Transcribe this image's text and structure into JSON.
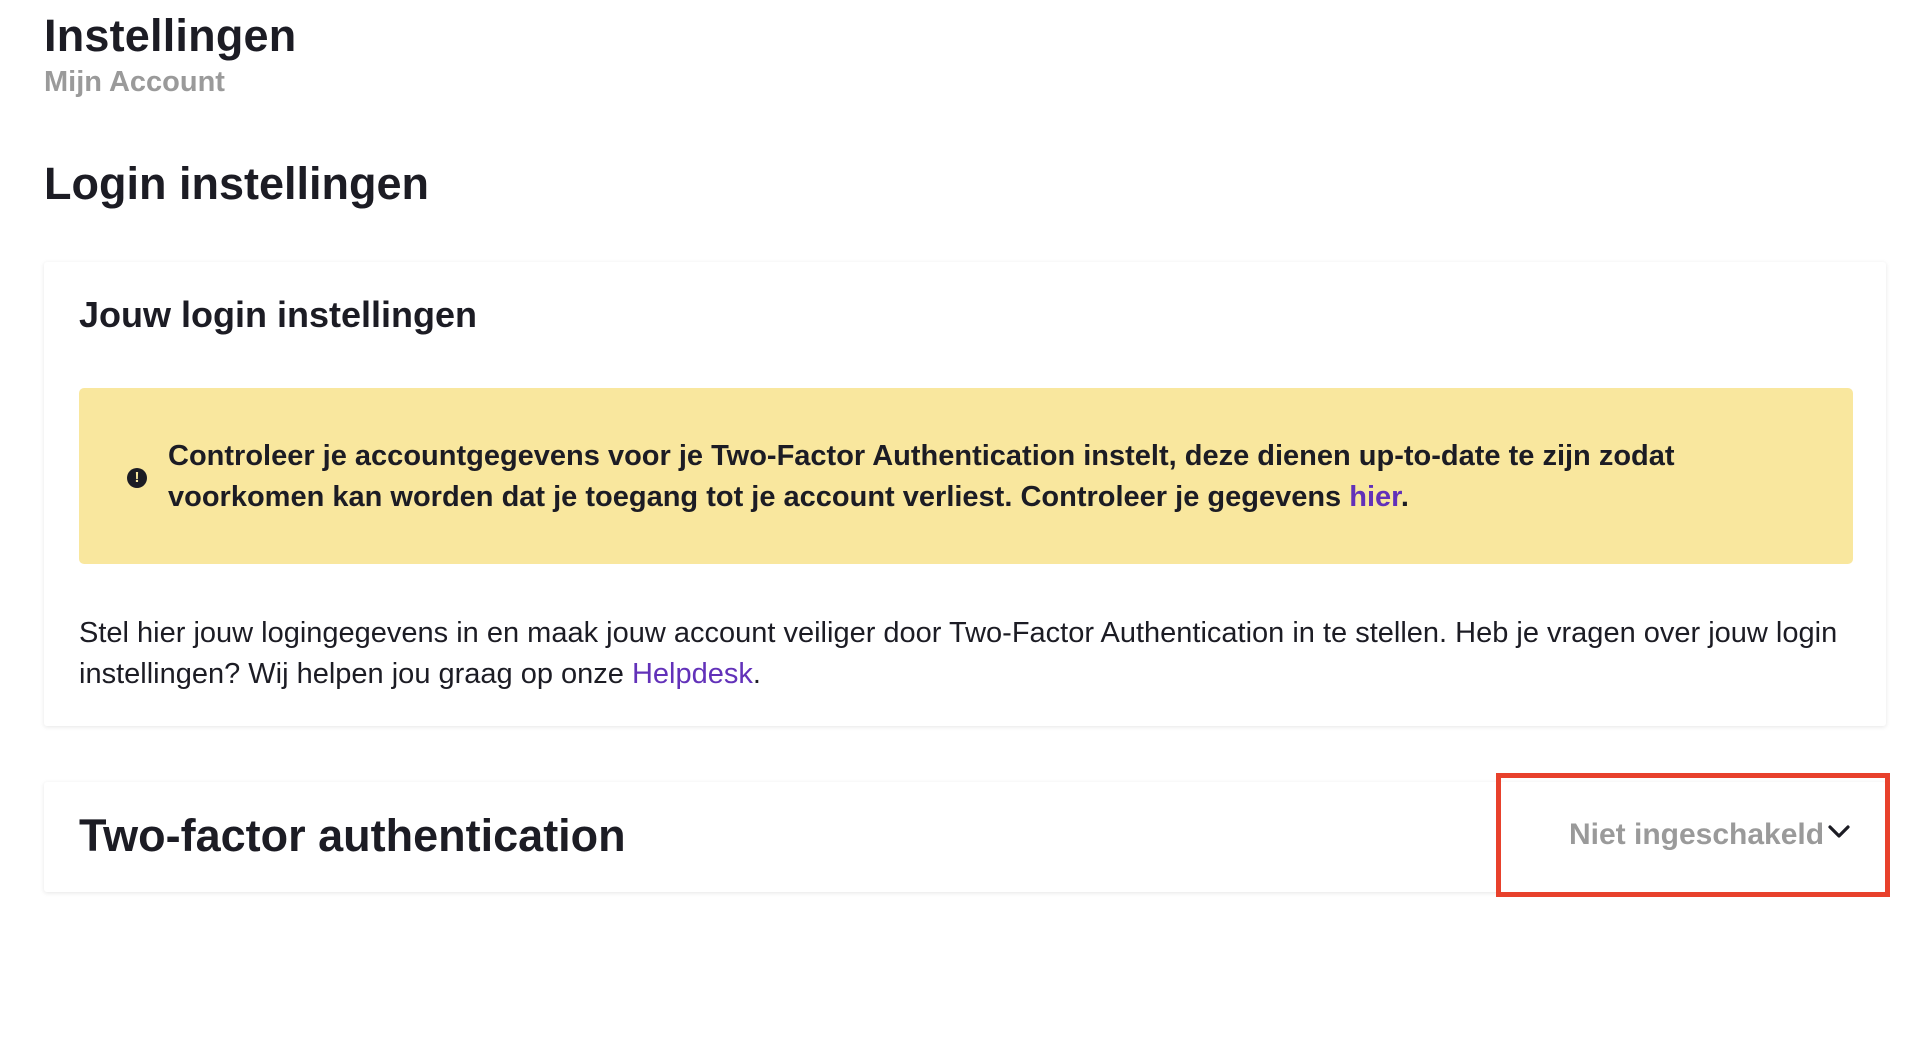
{
  "header": {
    "title": "Instellingen",
    "subtitle": "Mijn Account"
  },
  "section": {
    "title": "Login instellingen"
  },
  "login_card": {
    "heading": "Jouw login instellingen",
    "alert": {
      "icon": "exclamation-circle-icon",
      "text_before_link": "Controleer je accountgegevens voor je Two-Factor Authentication instelt, deze dienen up-to-date te zijn zodat voorkomen kan worden dat je toegang tot je account verliest. Controleer je gegevens ",
      "link_label": "hier",
      "text_after_link": "."
    },
    "body": {
      "text_before_link": "Stel hier jouw logingegevens in en maak jouw account veiliger door Two-Factor Authentication in te stellen. Heb je vragen over jouw login instellingen? Wij helpen jou graag op onze ",
      "link_label": "Helpdesk",
      "text_after_link": "."
    }
  },
  "twofa_card": {
    "title": "Two-factor authentication",
    "status": "Niet ingeschakeld",
    "toggle_icon": "chevron-down-icon"
  },
  "colors": {
    "alert_background": "#f9e79e",
    "link": "#6231b9",
    "muted_text": "#9a9a9a",
    "highlight_border": "#e8412c"
  }
}
